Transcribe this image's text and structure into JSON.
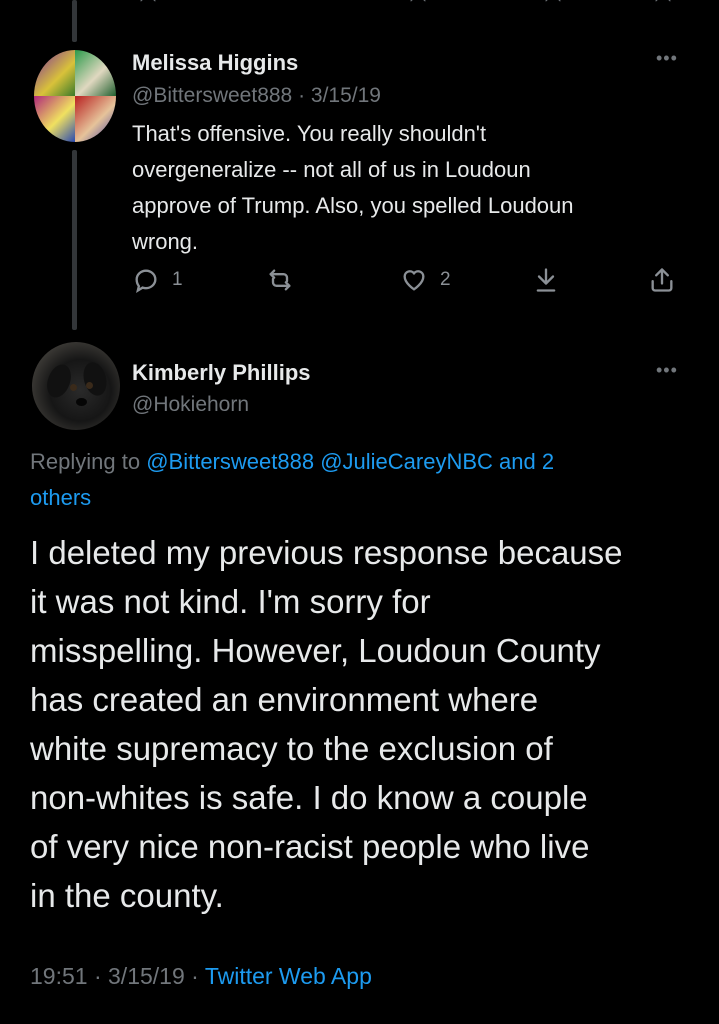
{
  "tweet1": {
    "author_name": "Melissa Higgins",
    "handle": "@Bittersweet888",
    "date": "3/15/19",
    "separator": "·",
    "text_lines": [
      "That's offensive. You really shouldn't",
      "overgeneralize -- not all of us in Loudoun",
      "approve of Trump. Also, you spelled Loudoun",
      "wrong."
    ],
    "reply_count": "1",
    "like_count": "2",
    "more_icon": "ellipsis-icon"
  },
  "tweet2": {
    "author_name": "Kimberly Phillips",
    "handle": "@Hokiehorn",
    "more_icon": "ellipsis-icon",
    "replying_prefix": "Replying to",
    "replying_handle1": "@Bittersweet888",
    "replying_handle2": "@JulieCareyNBC",
    "replying_suffix1": "and 2",
    "replying_suffix2": "others",
    "text_lines": [
      "I deleted my previous response because",
      "it was not kind.  I'm sorry for",
      "misspelling.  However, Loudoun County",
      "has created an environment where",
      "white supremacy to the exclusion of",
      "non-whites is safe.  I do know a couple",
      "of very nice non-racist people who live",
      "in the county."
    ],
    "time": "19:51",
    "date": "3/15/19",
    "source": "Twitter Web App",
    "separator": "·"
  },
  "colors": {
    "background": "#000000",
    "text": "#e7e9ea",
    "secondary": "#71767b",
    "link": "#1d9bf0"
  }
}
